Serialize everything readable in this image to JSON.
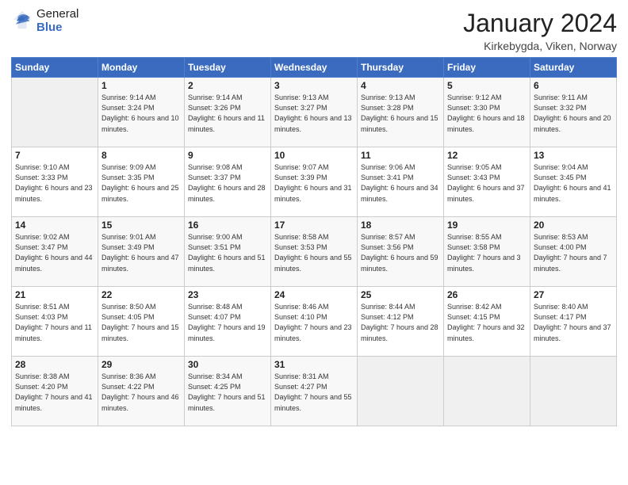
{
  "header": {
    "logo_general": "General",
    "logo_blue": "Blue",
    "title": "January 2024",
    "location": "Kirkebygda, Viken, Norway"
  },
  "weekdays": [
    "Sunday",
    "Monday",
    "Tuesday",
    "Wednesday",
    "Thursday",
    "Friday",
    "Saturday"
  ],
  "weeks": [
    [
      {
        "day": "",
        "sunrise": "",
        "sunset": "",
        "daylight": ""
      },
      {
        "day": "1",
        "sunrise": "Sunrise: 9:14 AM",
        "sunset": "Sunset: 3:24 PM",
        "daylight": "Daylight: 6 hours and 10 minutes."
      },
      {
        "day": "2",
        "sunrise": "Sunrise: 9:14 AM",
        "sunset": "Sunset: 3:26 PM",
        "daylight": "Daylight: 6 hours and 11 minutes."
      },
      {
        "day": "3",
        "sunrise": "Sunrise: 9:13 AM",
        "sunset": "Sunset: 3:27 PM",
        "daylight": "Daylight: 6 hours and 13 minutes."
      },
      {
        "day": "4",
        "sunrise": "Sunrise: 9:13 AM",
        "sunset": "Sunset: 3:28 PM",
        "daylight": "Daylight: 6 hours and 15 minutes."
      },
      {
        "day": "5",
        "sunrise": "Sunrise: 9:12 AM",
        "sunset": "Sunset: 3:30 PM",
        "daylight": "Daylight: 6 hours and 18 minutes."
      },
      {
        "day": "6",
        "sunrise": "Sunrise: 9:11 AM",
        "sunset": "Sunset: 3:32 PM",
        "daylight": "Daylight: 6 hours and 20 minutes."
      }
    ],
    [
      {
        "day": "7",
        "sunrise": "Sunrise: 9:10 AM",
        "sunset": "Sunset: 3:33 PM",
        "daylight": "Daylight: 6 hours and 23 minutes."
      },
      {
        "day": "8",
        "sunrise": "Sunrise: 9:09 AM",
        "sunset": "Sunset: 3:35 PM",
        "daylight": "Daylight: 6 hours and 25 minutes."
      },
      {
        "day": "9",
        "sunrise": "Sunrise: 9:08 AM",
        "sunset": "Sunset: 3:37 PM",
        "daylight": "Daylight: 6 hours and 28 minutes."
      },
      {
        "day": "10",
        "sunrise": "Sunrise: 9:07 AM",
        "sunset": "Sunset: 3:39 PM",
        "daylight": "Daylight: 6 hours and 31 minutes."
      },
      {
        "day": "11",
        "sunrise": "Sunrise: 9:06 AM",
        "sunset": "Sunset: 3:41 PM",
        "daylight": "Daylight: 6 hours and 34 minutes."
      },
      {
        "day": "12",
        "sunrise": "Sunrise: 9:05 AM",
        "sunset": "Sunset: 3:43 PM",
        "daylight": "Daylight: 6 hours and 37 minutes."
      },
      {
        "day": "13",
        "sunrise": "Sunrise: 9:04 AM",
        "sunset": "Sunset: 3:45 PM",
        "daylight": "Daylight: 6 hours and 41 minutes."
      }
    ],
    [
      {
        "day": "14",
        "sunrise": "Sunrise: 9:02 AM",
        "sunset": "Sunset: 3:47 PM",
        "daylight": "Daylight: 6 hours and 44 minutes."
      },
      {
        "day": "15",
        "sunrise": "Sunrise: 9:01 AM",
        "sunset": "Sunset: 3:49 PM",
        "daylight": "Daylight: 6 hours and 47 minutes."
      },
      {
        "day": "16",
        "sunrise": "Sunrise: 9:00 AM",
        "sunset": "Sunset: 3:51 PM",
        "daylight": "Daylight: 6 hours and 51 minutes."
      },
      {
        "day": "17",
        "sunrise": "Sunrise: 8:58 AM",
        "sunset": "Sunset: 3:53 PM",
        "daylight": "Daylight: 6 hours and 55 minutes."
      },
      {
        "day": "18",
        "sunrise": "Sunrise: 8:57 AM",
        "sunset": "Sunset: 3:56 PM",
        "daylight": "Daylight: 6 hours and 59 minutes."
      },
      {
        "day": "19",
        "sunrise": "Sunrise: 8:55 AM",
        "sunset": "Sunset: 3:58 PM",
        "daylight": "Daylight: 7 hours and 3 minutes."
      },
      {
        "day": "20",
        "sunrise": "Sunrise: 8:53 AM",
        "sunset": "Sunset: 4:00 PM",
        "daylight": "Daylight: 7 hours and 7 minutes."
      }
    ],
    [
      {
        "day": "21",
        "sunrise": "Sunrise: 8:51 AM",
        "sunset": "Sunset: 4:03 PM",
        "daylight": "Daylight: 7 hours and 11 minutes."
      },
      {
        "day": "22",
        "sunrise": "Sunrise: 8:50 AM",
        "sunset": "Sunset: 4:05 PM",
        "daylight": "Daylight: 7 hours and 15 minutes."
      },
      {
        "day": "23",
        "sunrise": "Sunrise: 8:48 AM",
        "sunset": "Sunset: 4:07 PM",
        "daylight": "Daylight: 7 hours and 19 minutes."
      },
      {
        "day": "24",
        "sunrise": "Sunrise: 8:46 AM",
        "sunset": "Sunset: 4:10 PM",
        "daylight": "Daylight: 7 hours and 23 minutes."
      },
      {
        "day": "25",
        "sunrise": "Sunrise: 8:44 AM",
        "sunset": "Sunset: 4:12 PM",
        "daylight": "Daylight: 7 hours and 28 minutes."
      },
      {
        "day": "26",
        "sunrise": "Sunrise: 8:42 AM",
        "sunset": "Sunset: 4:15 PM",
        "daylight": "Daylight: 7 hours and 32 minutes."
      },
      {
        "day": "27",
        "sunrise": "Sunrise: 8:40 AM",
        "sunset": "Sunset: 4:17 PM",
        "daylight": "Daylight: 7 hours and 37 minutes."
      }
    ],
    [
      {
        "day": "28",
        "sunrise": "Sunrise: 8:38 AM",
        "sunset": "Sunset: 4:20 PM",
        "daylight": "Daylight: 7 hours and 41 minutes."
      },
      {
        "day": "29",
        "sunrise": "Sunrise: 8:36 AM",
        "sunset": "Sunset: 4:22 PM",
        "daylight": "Daylight: 7 hours and 46 minutes."
      },
      {
        "day": "30",
        "sunrise": "Sunrise: 8:34 AM",
        "sunset": "Sunset: 4:25 PM",
        "daylight": "Daylight: 7 hours and 51 minutes."
      },
      {
        "day": "31",
        "sunrise": "Sunrise: 8:31 AM",
        "sunset": "Sunset: 4:27 PM",
        "daylight": "Daylight: 7 hours and 55 minutes."
      },
      {
        "day": "",
        "sunrise": "",
        "sunset": "",
        "daylight": ""
      },
      {
        "day": "",
        "sunrise": "",
        "sunset": "",
        "daylight": ""
      },
      {
        "day": "",
        "sunrise": "",
        "sunset": "",
        "daylight": ""
      }
    ]
  ]
}
